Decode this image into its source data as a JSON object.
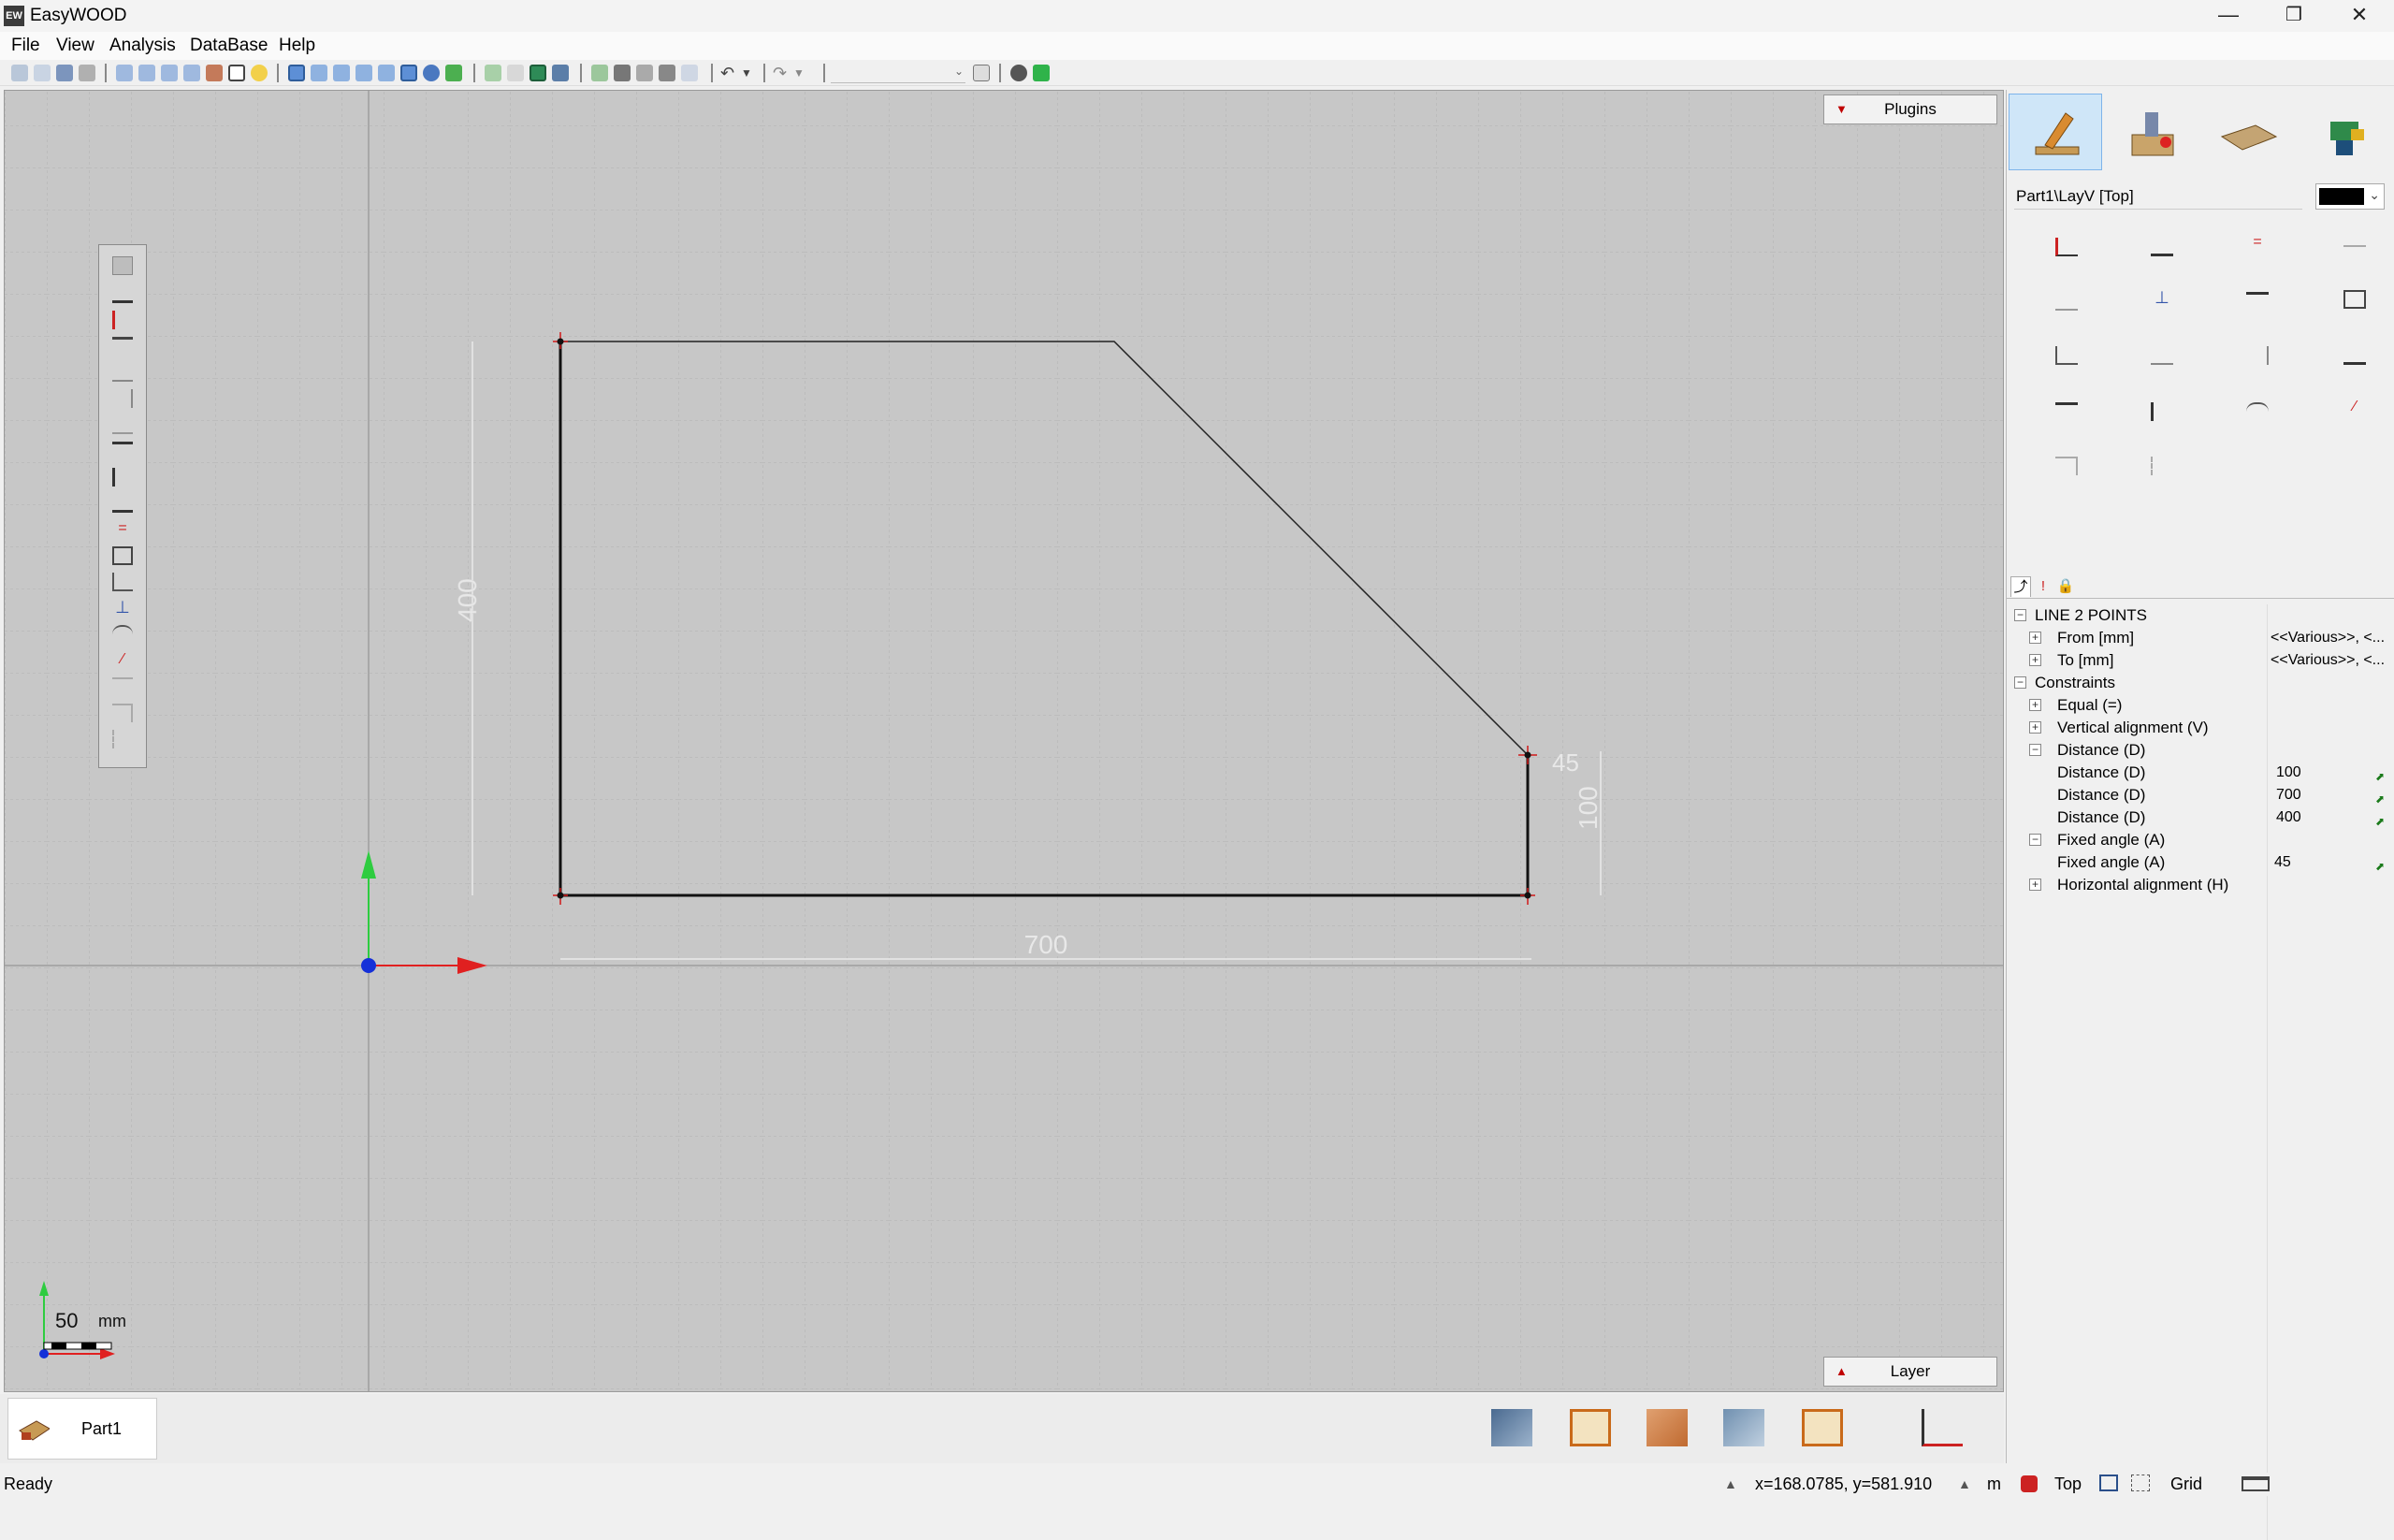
{
  "window": {
    "logo": "EW",
    "title": "EasyWOOD",
    "controls": {
      "minimize": "—",
      "restore": "❐",
      "close": "✕"
    }
  },
  "menu": [
    "File",
    "View",
    "Analysis",
    "DataBase",
    "Help"
  ],
  "viewport": {
    "plugins_label": "Plugins",
    "layer_label": "Layer",
    "dim_400": "400",
    "dim_700": "700",
    "dim_100": "100",
    "dim_45": "45",
    "scale_value": "50",
    "scale_unit": "mm"
  },
  "right_panel": {
    "layer_path": "Part1\\LayV [Top]",
    "current_color": "#000000",
    "property_group": "LINE 2 POINTS",
    "from_label": "From [mm]",
    "from_value": "<<Various>>, <...",
    "to_label": "To [mm]",
    "to_value": "<<Various>>, <...",
    "constraints_label": "Constraints",
    "equal_label": "Equal (=)",
    "vertical_label": "Vertical alignment (V)",
    "distance_group": "Distance (D)",
    "distances": [
      {
        "label": "Distance (D)",
        "value": "100"
      },
      {
        "label": "Distance (D)",
        "value": "700"
      },
      {
        "label": "Distance (D)",
        "value": "400"
      }
    ],
    "fixed_angle_group": "Fixed angle (A)",
    "fixed_angle": {
      "label": "Fixed angle (A)",
      "value": "45"
    },
    "horizontal_label": "Horizontal alignment (H)"
  },
  "part_tab": {
    "label": "Part1"
  },
  "status": {
    "ready": "Ready",
    "coords": "x=168.0785, y=581.910",
    "unit": "m",
    "view": "Top",
    "grid": "Grid"
  }
}
